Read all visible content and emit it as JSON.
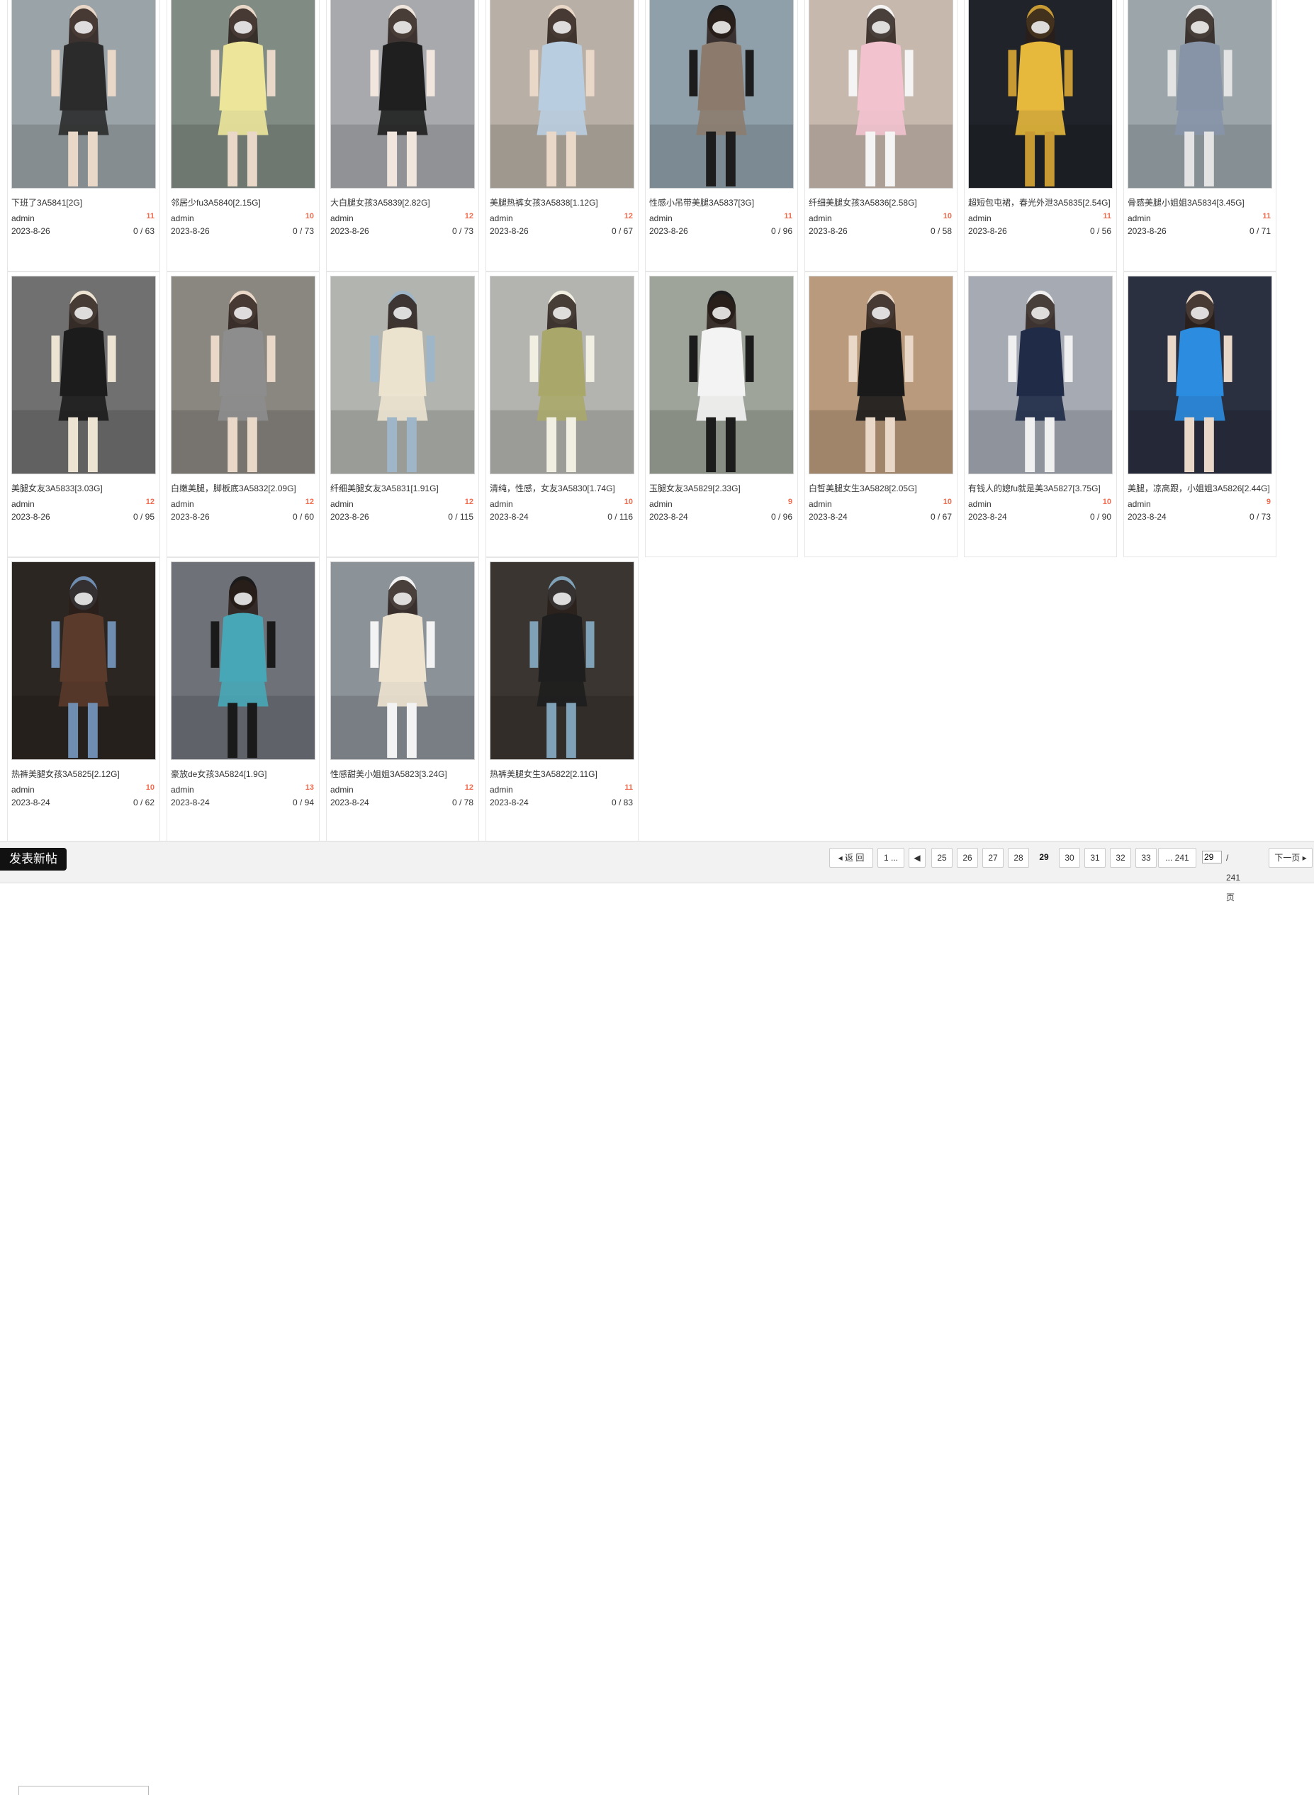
{
  "posts": [
    {
      "title": "下班了3A5841[2G]",
      "author": "admin",
      "badge": "11",
      "date": "2023-8-26",
      "stats": "0 / 63"
    },
    {
      "title": "邻居少fu3A5840[2.15G]",
      "author": "admin",
      "badge": "10",
      "date": "2023-8-26",
      "stats": "0 / 73"
    },
    {
      "title": "大白腿女孩3A5839[2.82G]",
      "author": "admin",
      "badge": "12",
      "date": "2023-8-26",
      "stats": "0 / 73"
    },
    {
      "title": "美腿热裤女孩3A5838[1.12G]",
      "author": "admin",
      "badge": "12",
      "date": "2023-8-26",
      "stats": "0 / 67"
    },
    {
      "title": "性感小吊带美腿3A5837[3G]",
      "author": "admin",
      "badge": "11",
      "date": "2023-8-26",
      "stats": "0 / 96"
    },
    {
      "title": "纤细美腿女孩3A5836[2.58G]",
      "author": "admin",
      "badge": "10",
      "date": "2023-8-26",
      "stats": "0 / 58"
    },
    {
      "title": "超短包屯裙，春光外泄3A5835[2.54G]",
      "author": "admin",
      "badge": "11",
      "date": "2023-8-26",
      "stats": "0 / 56"
    },
    {
      "title": "骨感美腿小姐姐3A5834[3.45G]",
      "author": "admin",
      "badge": "11",
      "date": "2023-8-26",
      "stats": "0 / 71"
    },
    {
      "title": "美腿女友3A5833[3.03G]",
      "author": "admin",
      "badge": "12",
      "date": "2023-8-26",
      "stats": "0 / 95"
    },
    {
      "title": "白嫩美腿，脚板底3A5832[2.09G]",
      "author": "admin",
      "badge": "12",
      "date": "2023-8-26",
      "stats": "0 / 60"
    },
    {
      "title": "纤细美腿女友3A5831[1.91G]",
      "author": "admin",
      "badge": "12",
      "date": "2023-8-26",
      "stats": "0 / 115"
    },
    {
      "title": "清纯，性感，女友3A5830[1.74G]",
      "author": "admin",
      "badge": "10",
      "date": "2023-8-24",
      "stats": "0 / 116"
    },
    {
      "title": "玉腿女友3A5829[2.33G]",
      "author": "admin",
      "badge": "9",
      "date": "2023-8-24",
      "stats": "0 / 96"
    },
    {
      "title": "白皙美腿女生3A5828[2.05G]",
      "author": "admin",
      "badge": "10",
      "date": "2023-8-24",
      "stats": "0 / 67"
    },
    {
      "title": "有钱人的媳fu就是美3A5827[3.75G]",
      "author": "admin",
      "badge": "10",
      "date": "2023-8-24",
      "stats": "0 / 90"
    },
    {
      "title": "美腿，凉高跟，小姐姐3A5826[2.44G]",
      "author": "admin",
      "badge": "9",
      "date": "2023-8-24",
      "stats": "0 / 73"
    },
    {
      "title": "热裤美腿女孩3A5825[2.12G]",
      "author": "admin",
      "badge": "10",
      "date": "2023-8-24",
      "stats": "0 / 62"
    },
    {
      "title": "豪放de女孩3A5824[1.9G]",
      "author": "admin",
      "badge": "13",
      "date": "2023-8-24",
      "stats": "0 / 94"
    },
    {
      "title": "性感甜美小姐姐3A5823[3.24G]",
      "author": "admin",
      "badge": "12",
      "date": "2023-8-24",
      "stats": "0 / 78"
    },
    {
      "title": "热裤美腿女生3A5822[2.11G]",
      "author": "admin",
      "badge": "11",
      "date": "2023-8-24",
      "stats": "0 / 83"
    }
  ],
  "thumb_palettes": [
    [
      "#9aa3a8",
      "#2b2b2b",
      "#e9d7c8"
    ],
    [
      "#7f8b83",
      "#ece59a",
      "#e9d7c8"
    ],
    [
      "#a7a9ad",
      "#1f1f1f",
      "#f0e6dd"
    ],
    [
      "#b8b0a6",
      "#b9cde0",
      "#e9d7c8"
    ],
    [
      "#8fa0ab",
      "#8c7b6d",
      "#1d1d1d"
    ],
    [
      "#c7b8ad",
      "#f2c2cf",
      "#f4f4f4"
    ],
    [
      "#20242a",
      "#e6b83c",
      "#c79a33"
    ],
    [
      "#9ba5aa",
      "#8794a8",
      "#e3e3e3"
    ],
    [
      "#707070",
      "#1c1c1c",
      "#ece3d2"
    ],
    [
      "#8a8680",
      "#8d8d8d",
      "#e9d7c8"
    ],
    [
      "#b2b4b0",
      "#ece3cf",
      "#9fb6c8"
    ],
    [
      "#b3b3b0",
      "#a9a86a",
      "#f0efe2"
    ],
    [
      "#9ea49a",
      "#f3f3f3",
      "#1c1c1c"
    ],
    [
      "#b99a7c",
      "#1a1a1a",
      "#e9d7c8"
    ],
    [
      "#a6aab3",
      "#1f2b47",
      "#f0f0f0"
    ],
    [
      "#2b3040",
      "#2b8ce0",
      "#e9d7c8"
    ],
    [
      "#2c2622",
      "#5a3a2a",
      "#6f8db0"
    ],
    [
      "#6e7278",
      "#47a7b6",
      "#1a1a1a"
    ],
    [
      "#8b9298",
      "#ede3cf",
      "#f3f3f3"
    ],
    [
      "#3a3530",
      "#1e1e1e",
      "#7fa2b8"
    ]
  ],
  "new_post_label": "发表新帖",
  "pagination": {
    "back_label": "返 回",
    "first_label": "1 ...",
    "pages": [
      "25",
      "26",
      "27",
      "28",
      "29",
      "30",
      "31",
      "32",
      "33"
    ],
    "current": "29",
    "last_label": "... 241",
    "input_value": "29",
    "total_label": "/ 241 页",
    "next_label": "下一页"
  }
}
